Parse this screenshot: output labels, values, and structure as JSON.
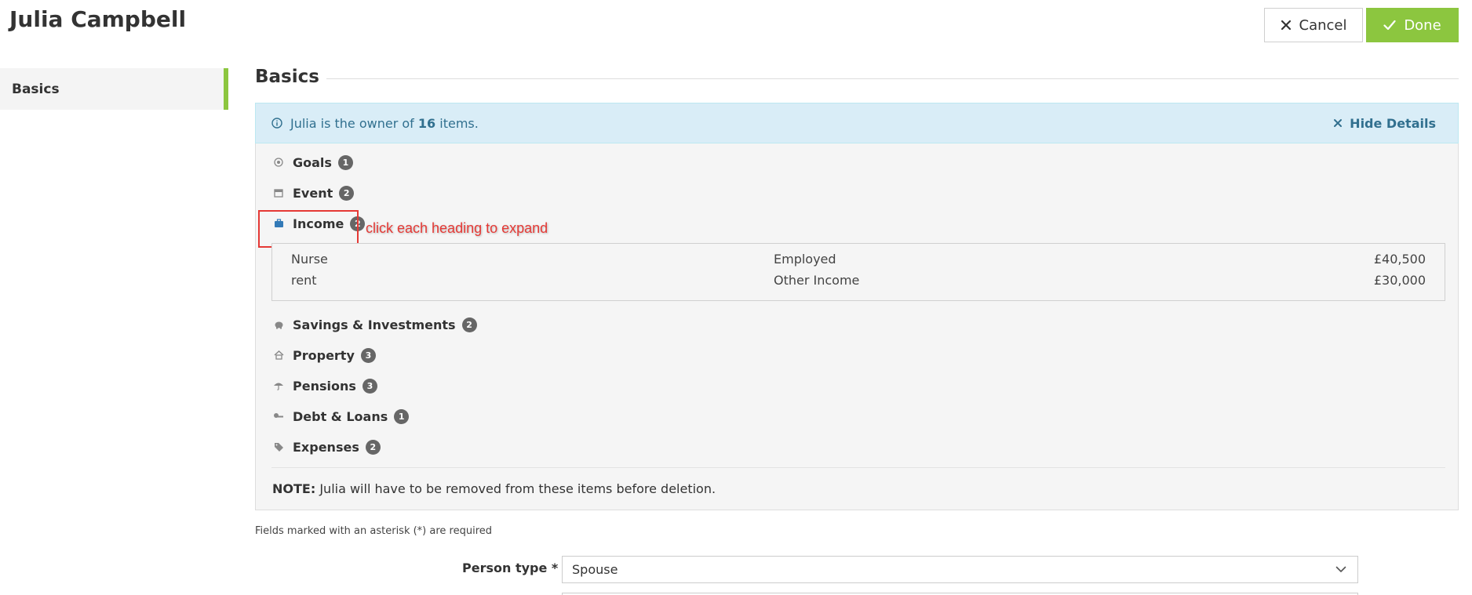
{
  "header": {
    "title": "Julia Campbell",
    "cancel_label": "Cancel",
    "done_label": "Done"
  },
  "sidebar": {
    "items": [
      {
        "label": "Basics"
      }
    ]
  },
  "section": {
    "heading": "Basics"
  },
  "info_banner": {
    "message_prefix": "Julia is the owner of",
    "count": "16",
    "message_suffix": "items.",
    "hide_label": "Hide Details"
  },
  "categories": [
    {
      "label": "Goals",
      "count": "1",
      "icon": "target-icon"
    },
    {
      "label": "Event",
      "count": "2",
      "icon": "calendar-icon"
    },
    {
      "label": "Income",
      "count": "2",
      "icon": "briefcase-icon"
    },
    {
      "label": "Savings & Investments",
      "count": "2",
      "icon": "piggy-bank-icon"
    },
    {
      "label": "Property",
      "count": "3",
      "icon": "house-icon"
    },
    {
      "label": "Pensions",
      "count": "3",
      "icon": "umbrella-icon"
    },
    {
      "label": "Debt & Loans",
      "count": "1",
      "icon": "key-icon"
    },
    {
      "label": "Expenses",
      "count": "2",
      "icon": "tag-icon"
    }
  ],
  "annotation": {
    "text": "click each heading to expand"
  },
  "income_items": [
    {
      "name": "Nurse",
      "type": "Employed",
      "amount": "£40,500"
    },
    {
      "name": "rent",
      "type": "Other Income",
      "amount": "£30,000"
    }
  ],
  "note": {
    "label": "NOTE:",
    "text": "Julia will have to be removed from these items before deletion."
  },
  "form": {
    "required_note": "Fields marked with an asterisk (*) are required",
    "person_type_label": "Person type *",
    "person_type_value": "Spouse"
  },
  "colors": {
    "accent_green": "#8cc63f",
    "info_bg": "#d9edf7",
    "info_text": "#31708f",
    "annotation_red": "#e53935"
  }
}
